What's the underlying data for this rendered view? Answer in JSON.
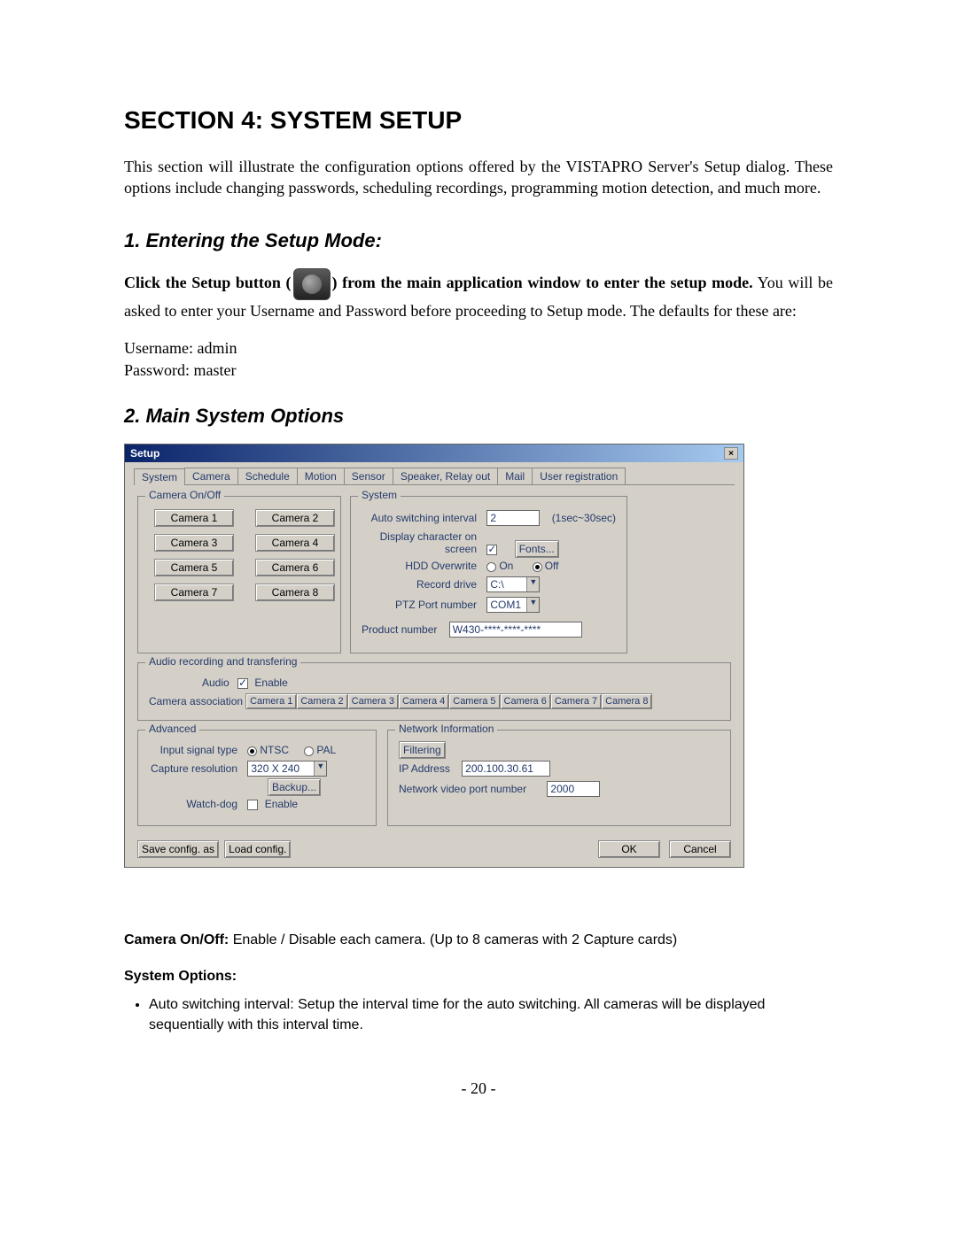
{
  "sectionTitle": "SECTION 4: SYSTEM SETUP",
  "intro": "This section will illustrate the configuration options offered by the VISTAPRO Server's Setup dialog. These options include changing passwords, scheduling recordings, programming motion detection, and much more.",
  "sub1": "1. Entering the Setup Mode:",
  "setupPara_a": "Click the Setup button (",
  "setupPara_b": ") from the main application window to enter the setup mode.",
  "setupPara_c": " You will be asked to enter your Username and Password before proceeding to Setup mode. The defaults for these are:",
  "userLine": "Username: admin",
  "passLine": "Password: master",
  "sub2": "2. Main System Options",
  "dialog": {
    "title": "Setup",
    "tabs": [
      "System",
      "Camera",
      "Schedule",
      "Motion",
      "Sensor",
      "Speaker, Relay out",
      "Mail",
      "User registration"
    ],
    "camOnOff": {
      "legend": "Camera On/Off",
      "buttons": [
        "Camera 1",
        "Camera 2",
        "Camera 3",
        "Camera 4",
        "Camera 5",
        "Camera 6",
        "Camera 7",
        "Camera 8"
      ]
    },
    "system": {
      "legend": "System",
      "autoSwitchLabel": "Auto switching interval",
      "autoSwitchVal": "2",
      "autoSwitchHint": "(1sec~30sec)",
      "dispCharLabel": "Display character on screen",
      "fontsBtn": "Fonts...",
      "hddLabel": "HDD Overwrite",
      "onLabel": "On",
      "offLabel": "Off",
      "recDriveLabel": "Record drive",
      "recDriveVal": "C:\\",
      "ptzLabel": "PTZ Port number",
      "ptzVal": "COM1",
      "prodLabel": "Product number",
      "prodVal": "W430-****-****-****"
    },
    "audio": {
      "legend": "Audio recording and transfering",
      "audioLabel": "Audio",
      "enableLabel": "Enable",
      "assocLabel": "Camera association",
      "cams": [
        "Camera 1",
        "Camera 2",
        "Camera 3",
        "Camera 4",
        "Camera 5",
        "Camera 6",
        "Camera 7",
        "Camera 8"
      ]
    },
    "advanced": {
      "legend": "Advanced",
      "sigLabel": "Input signal type",
      "ntsc": "NTSC",
      "pal": "PAL",
      "capLabel": "Capture resolution",
      "capVal": "320 X 240",
      "backupBtn": "Backup...",
      "wdLabel": "Watch-dog",
      "wdEnable": "Enable"
    },
    "network": {
      "legend": "Network Information",
      "filterBtn": "Filtering",
      "ipLabel": "IP Address",
      "ipVal": "200.100.30.61",
      "portLabel": "Network video port number",
      "portVal": "2000"
    },
    "saveBtn": "Save config. as",
    "loadBtn": "Load config.",
    "okBtn": "OK",
    "cancelBtn": "Cancel"
  },
  "camDesc_l": "Camera On/Off:",
  "camDesc_t": "  Enable / Disable each camera. (Up to 8 cameras with 2 Capture cards)",
  "sysOpt": "System Options:",
  "bullet1": "Auto switching interval: Setup the interval time for the auto switching. All cameras will be displayed sequentially with this interval time.",
  "pageNum": "- 20 -"
}
